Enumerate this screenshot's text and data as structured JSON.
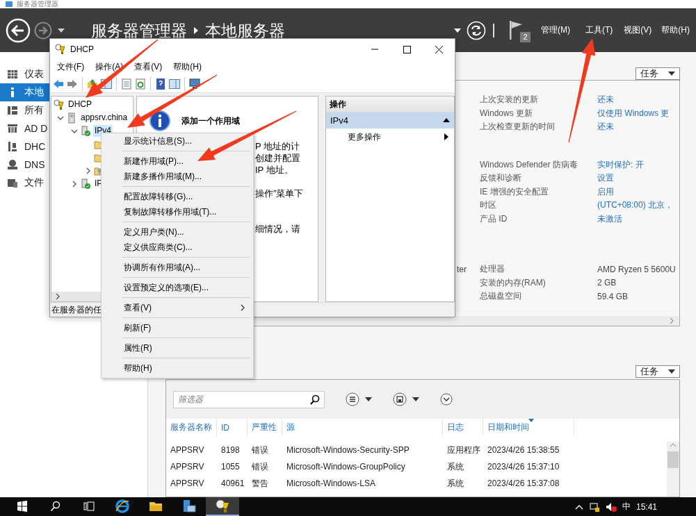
{
  "app_title": "服务器管理器",
  "header": {
    "breadcrumb": [
      "服务器管理器",
      "本地服务器"
    ],
    "notification_count": "2",
    "menus": [
      "管理(M)",
      "工具(T)",
      "视图(V)",
      "帮助(H)"
    ]
  },
  "sidebar": {
    "items": [
      {
        "label": "仪表",
        "kind": "dashboard",
        "selected": false
      },
      {
        "label": "本地",
        "kind": "local",
        "selected": true
      },
      {
        "label": "所有",
        "kind": "all",
        "selected": false
      },
      {
        "label": "AD D",
        "kind": "ad",
        "selected": false
      },
      {
        "label": "DHC",
        "kind": "dhcp",
        "selected": false
      },
      {
        "label": "DNS",
        "kind": "dns",
        "selected": false
      },
      {
        "label": "文件",
        "kind": "files",
        "selected": false
      }
    ]
  },
  "properties": {
    "task_button": "任务",
    "groups": [
      [
        {
          "label": "上次安装的更新",
          "value": "还未",
          "link": true
        },
        {
          "label": "Windows 更新",
          "value": "仅使用 Windows 更",
          "link": true
        },
        {
          "label": "上次检查更新的时间",
          "value": "还未",
          "link": true
        }
      ],
      [
        {
          "label": "Windows Defender 防病毒",
          "value": "实时保护: 开",
          "link": true
        },
        {
          "label": "反馈和诊断",
          "value": "设置",
          "link": true
        },
        {
          "label": "IE 增强的安全配置",
          "value": "启用",
          "link": true
        },
        {
          "label": "时区",
          "value": "(UTC+08:00) 北京，",
          "link": true
        },
        {
          "label": "产品 ID",
          "value": "未激活",
          "link": true
        }
      ],
      [
        {
          "fragment": "ter",
          "label": "处理器",
          "value": "AMD Ryzen 5 5600U",
          "link": false
        },
        {
          "label": "安装的内存(RAM)",
          "value": "2 GB",
          "link": false
        },
        {
          "label": "总磁盘空间",
          "value": "59.4 GB",
          "link": false
        }
      ]
    ]
  },
  "events": {
    "task_button": "任务",
    "filter_placeholder": "筛选器",
    "columns": [
      {
        "label": "服务器名称",
        "sorted": false
      },
      {
        "label": "ID",
        "sorted": false
      },
      {
        "label": "严重性",
        "sorted": false
      },
      {
        "label": "源",
        "sorted": false
      },
      {
        "label": "日志",
        "sorted": false
      },
      {
        "label": "日期和时间",
        "sorted": true
      }
    ],
    "rows": [
      [
        "APPSRV",
        "8198",
        "错误",
        "Microsoft-Windows-Security-SPP",
        "应用程序",
        "2023/4/26 15:38:55"
      ],
      [
        "APPSRV",
        "1055",
        "错误",
        "Microsoft-Windows-GroupPolicy",
        "系统",
        "2023/4/26 15:37:10"
      ],
      [
        "APPSRV",
        "40961",
        "警告",
        "Microsoft-Windows-LSA",
        "系统",
        "2023/4/26 15:37:08"
      ]
    ]
  },
  "dhcp_window": {
    "title": "DHCP",
    "menus": [
      "文件(F)",
      "操作(A)",
      "查看(V)",
      "帮助(H)"
    ],
    "tree": [
      {
        "label": "DHCP",
        "kind": "root",
        "selected": false,
        "children": [
          {
            "label": "appsrv.china",
            "kind": "server",
            "expanded": true,
            "selected": false,
            "children": [
              {
                "label": "IPv4",
                "kind": "protocol",
                "expanded": true,
                "selected": true,
                "children": [
                  {
                    "kind": "folder"
                  },
                  {
                    "kind": "folder"
                  },
                  {
                    "kind": "filter",
                    "expanded": false
                  }
                ]
              },
              {
                "label": "IP",
                "kind": "protocol",
                "expanded": false,
                "selected": false
              }
            ]
          }
        ]
      }
    ],
    "content": {
      "heading": "添加一个作用域",
      "paragraphs": [
        [
          "P 地址的计",
          "创建并配置",
          "IP 地址。"
        ],
        [
          "操作”菜单下"
        ],
        [
          "细情况，请"
        ]
      ]
    },
    "actions": {
      "header": "操作",
      "section": "IPv4",
      "expanded": true,
      "items": [
        {
          "label": "更多操作",
          "submenu": true
        }
      ]
    },
    "status": "在服务器的任"
  },
  "context_menu": {
    "groups": [
      [
        {
          "label": "显示统计信息(S)...",
          "submenu": false
        }
      ],
      [
        {
          "label": "新建作用域(P)...",
          "submenu": false
        },
        {
          "label": "新建多播作用域(M)...",
          "submenu": false
        }
      ],
      [
        {
          "label": "配置故障转移(G)...",
          "submenu": false
        },
        {
          "label": "复制故障转移作用域(T)...",
          "submenu": false
        }
      ],
      [
        {
          "label": "定义用户类(N)...",
          "submenu": false
        },
        {
          "label": "定义供应商类(C)...",
          "submenu": false
        }
      ],
      [
        {
          "label": "协调所有作用域(A)...",
          "submenu": false
        }
      ],
      [
        {
          "label": "设置预定义的选项(E)...",
          "submenu": false
        }
      ],
      [
        {
          "label": "查看(V)",
          "submenu": true
        }
      ],
      [
        {
          "label": "刷新(F)",
          "submenu": false
        }
      ],
      [
        {
          "label": "属性(R)",
          "submenu": false
        }
      ],
      [
        {
          "label": "帮助(H)",
          "submenu": false
        }
      ]
    ]
  },
  "taskbar": {
    "items": [
      {
        "kind": "start",
        "active": false
      },
      {
        "kind": "search",
        "active": false
      },
      {
        "kind": "taskview",
        "active": false
      },
      {
        "kind": "browser",
        "active": false
      },
      {
        "kind": "folder",
        "active": false
      },
      {
        "kind": "server",
        "active": false
      },
      {
        "kind": "dhcp",
        "active": true
      }
    ],
    "ime": "中",
    "clock": "15:41"
  }
}
